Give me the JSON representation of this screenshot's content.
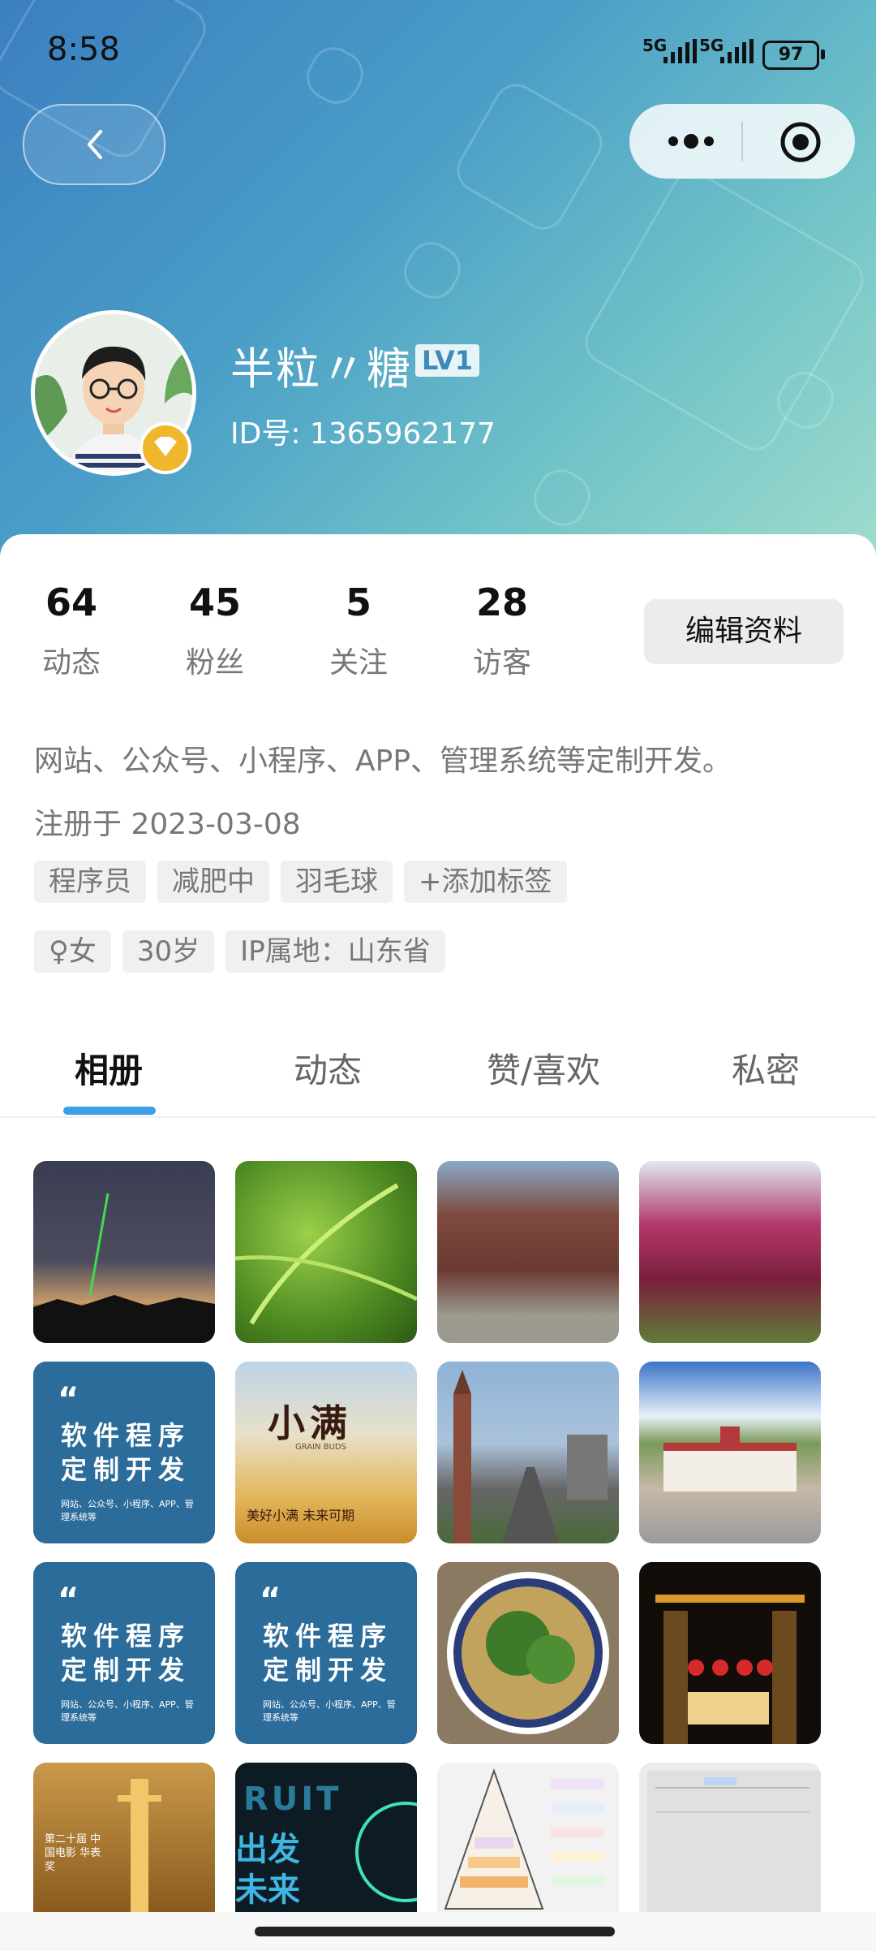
{
  "status_bar": {
    "time": "8:58",
    "signal1": "5G",
    "signal2": "5G",
    "battery": "97"
  },
  "profile": {
    "username": "半粒〃糖",
    "level": "LV1",
    "id_text": "ID号: 1365962177"
  },
  "stats": [
    {
      "value": "64",
      "label": "动态"
    },
    {
      "value": "45",
      "label": "粉丝"
    },
    {
      "value": "5",
      "label": "关注"
    },
    {
      "value": "28",
      "label": "访客"
    }
  ],
  "edit_button": "编辑资料",
  "bio": "网站、公众号、小程序、APP、管理系统等定制开发。",
  "registered": "注册于 2023-03-08",
  "tags": [
    "程序员",
    "减肥中",
    "羽毛球",
    "+添加标签"
  ],
  "info_tags": [
    "♀女",
    "30岁",
    "IP属地：山东省"
  ],
  "tabs": [
    "相册",
    "动态",
    "赞/喜欢",
    "私密"
  ],
  "active_tab": "相册",
  "photos": {
    "promo": {
      "quote": "“",
      "line1": "软件程序",
      "line2": "定制开发",
      "line3": "网站、公众号、小程序、APP、管理系统等"
    },
    "xiaoman": {
      "title": "小满",
      "sub": "GRAIN BUDS",
      "foot": "美好小满  未来可期"
    },
    "banner_1": "RUIT",
    "banner_2": "出发",
    "banner_3": "未来",
    "award": "第二十届 中国电影 华表奖"
  },
  "colors": {
    "accent": "#3aa0e8",
    "promo_bg": "#2c6c9a",
    "badge": "#f0b62c"
  }
}
